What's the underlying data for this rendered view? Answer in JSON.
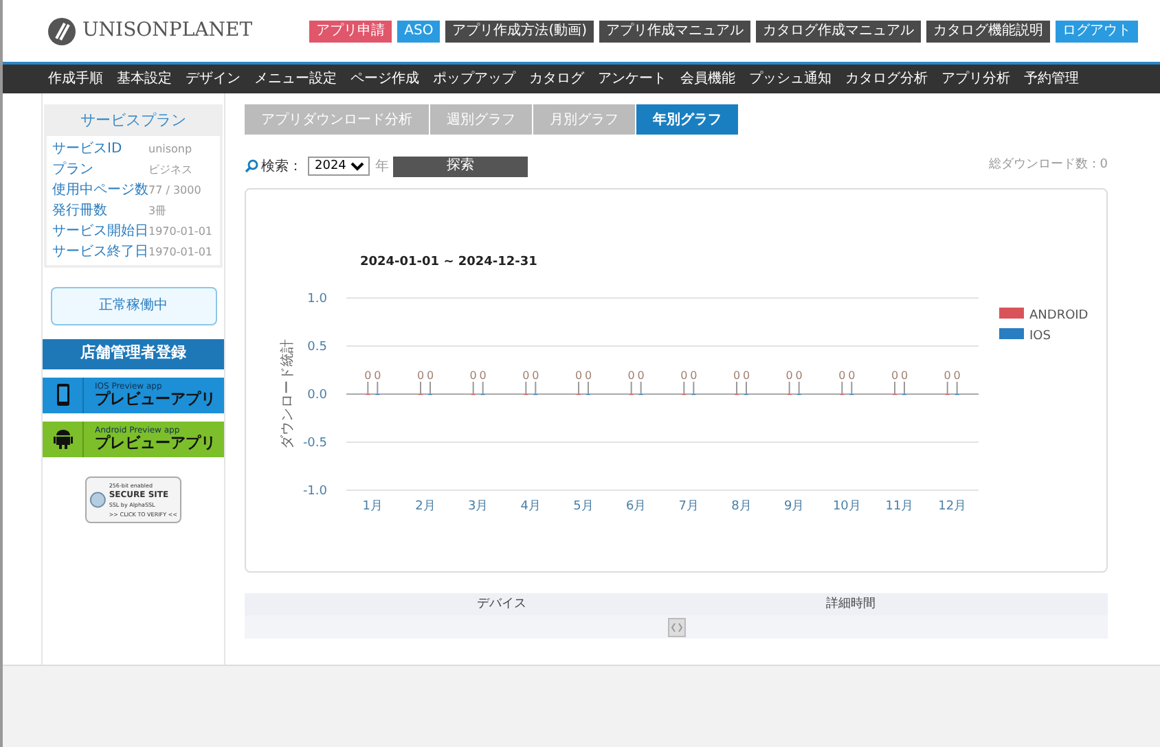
{
  "header": {
    "logo": "UNISONPLANET",
    "buttons": [
      {
        "label": "アプリ申請",
        "color": "#e0566b"
      },
      {
        "label": "ASO",
        "color": "#2a9be0"
      },
      {
        "label": "アプリ作成方法(動画)",
        "color": "#4a4a4a"
      },
      {
        "label": "アプリ作成マニュアル",
        "color": "#4a4a4a"
      },
      {
        "label": "カタログ作成マニュアル",
        "color": "#4a4a4a"
      },
      {
        "label": "カタログ機能説明",
        "color": "#4a4a4a"
      },
      {
        "label": "ログアウト",
        "color": "#2a9be0"
      }
    ]
  },
  "nav": [
    "作成手順",
    "基本設定",
    "デザイン",
    "メニュー設定",
    "ページ作成",
    "ポップアップ",
    "カタログ",
    "アンケート",
    "会員機能",
    "プッシュ通知",
    "カタログ分析",
    "アプリ分析",
    "予約管理"
  ],
  "sidebar": {
    "plan_title": "サービスプラン",
    "plan_rows": [
      {
        "label": "サービスID",
        "value": "unisonp"
      },
      {
        "label": "プラン",
        "value": "ビジネス"
      },
      {
        "label": "使用中ページ数",
        "value": "77 / 3000"
      },
      {
        "label": "発行冊数",
        "value": "3冊"
      },
      {
        "label": "サービス開始日",
        "value": "1970-01-01"
      },
      {
        "label": "サービス終了日",
        "value": "1970-01-01"
      }
    ],
    "status": "正常稼働中",
    "register_button": "店舗管理者登録",
    "preview_buttons": [
      {
        "kind": "ios",
        "caption": "IOS Preview app",
        "label": "プレビューアプリ"
      },
      {
        "kind": "android",
        "caption": "Android Preview app",
        "label": "プレビューアプリ"
      }
    ],
    "ssl_badge": {
      "line_1": "256-bit enabled",
      "line_2": "SECURE SITE",
      "line_3": "SSL by AlphaSSL",
      "line_4": ">> CLICK TO VERIFY <<"
    }
  },
  "tabs": [
    {
      "label": "アプリダウンロード分析",
      "selected": false
    },
    {
      "label": "週別グラフ",
      "selected": false
    },
    {
      "label": "月別グラフ",
      "selected": false
    },
    {
      "label": "年別グラフ",
      "selected": true
    }
  ],
  "search": {
    "label": "検索：",
    "year": "2024",
    "year_unit": "年",
    "button": "探索",
    "total": "総ダウンロード数：0"
  },
  "chart": {
    "chart_data": {
      "type": "bar",
      "title": "2024-01-01 ~ 2024-12-31",
      "ylabel": "ダウンロード統計",
      "categories": [
        "1月",
        "2月",
        "3月",
        "4月",
        "5月",
        "6月",
        "7月",
        "8月",
        "9月",
        "10月",
        "11月",
        "12月"
      ],
      "series": [
        {
          "name": "ANDROID",
          "color": "#d9545a",
          "values": [
            0,
            0,
            0,
            0,
            0,
            0,
            0,
            0,
            0,
            0,
            0,
            0
          ]
        },
        {
          "name": "IOS",
          "color": "#2a7dc0",
          "values": [
            0,
            0,
            0,
            0,
            0,
            0,
            0,
            0,
            0,
            0,
            0,
            0
          ]
        }
      ],
      "ylim": [
        -1,
        1
      ],
      "yticks": [
        {
          "value": -1,
          "label": "-1.0"
        },
        {
          "value": -0.5,
          "label": "-0.5"
        },
        {
          "value": 0,
          "label": "0.0"
        },
        {
          "value": 0.5,
          "label": "0.5"
        },
        {
          "value": 1,
          "label": "1.0"
        }
      ],
      "data_labels": true,
      "legend": true
    }
  },
  "table": {
    "columns": [
      "デバイス",
      "詳細時間"
    ]
  }
}
